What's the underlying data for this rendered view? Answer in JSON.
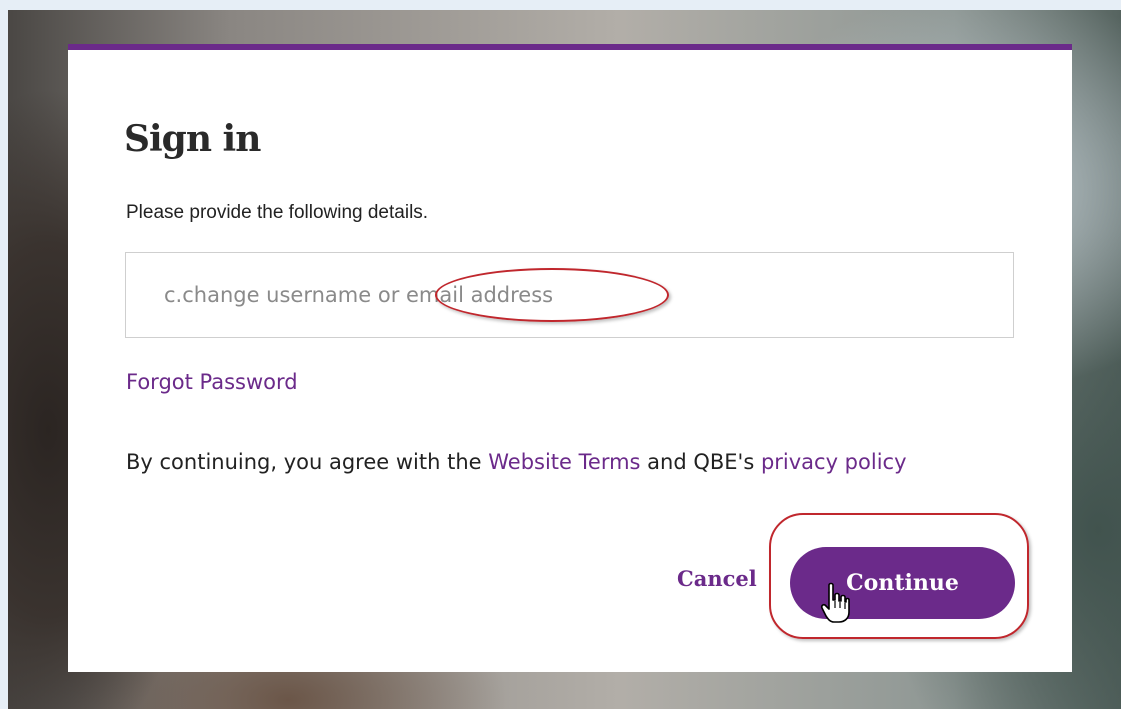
{
  "dialog": {
    "title": "Sign in",
    "instructions": "Please provide the following details.",
    "username_field": {
      "value": "",
      "placeholder": "c.change username or email address"
    },
    "forgot_password_link": "Forgot Password",
    "consent": {
      "prefix": "By continuing, you agree with the ",
      "website_terms_link": "Website Terms",
      "middle": " and QBE's ",
      "privacy_policy_link": "privacy policy"
    },
    "cancel_label": "Cancel",
    "continue_label": "Continue"
  },
  "colors": {
    "accent": "#6b2a8a",
    "annotation": "#c0272d"
  },
  "icons": {
    "cursor": "hand-pointer-icon"
  }
}
